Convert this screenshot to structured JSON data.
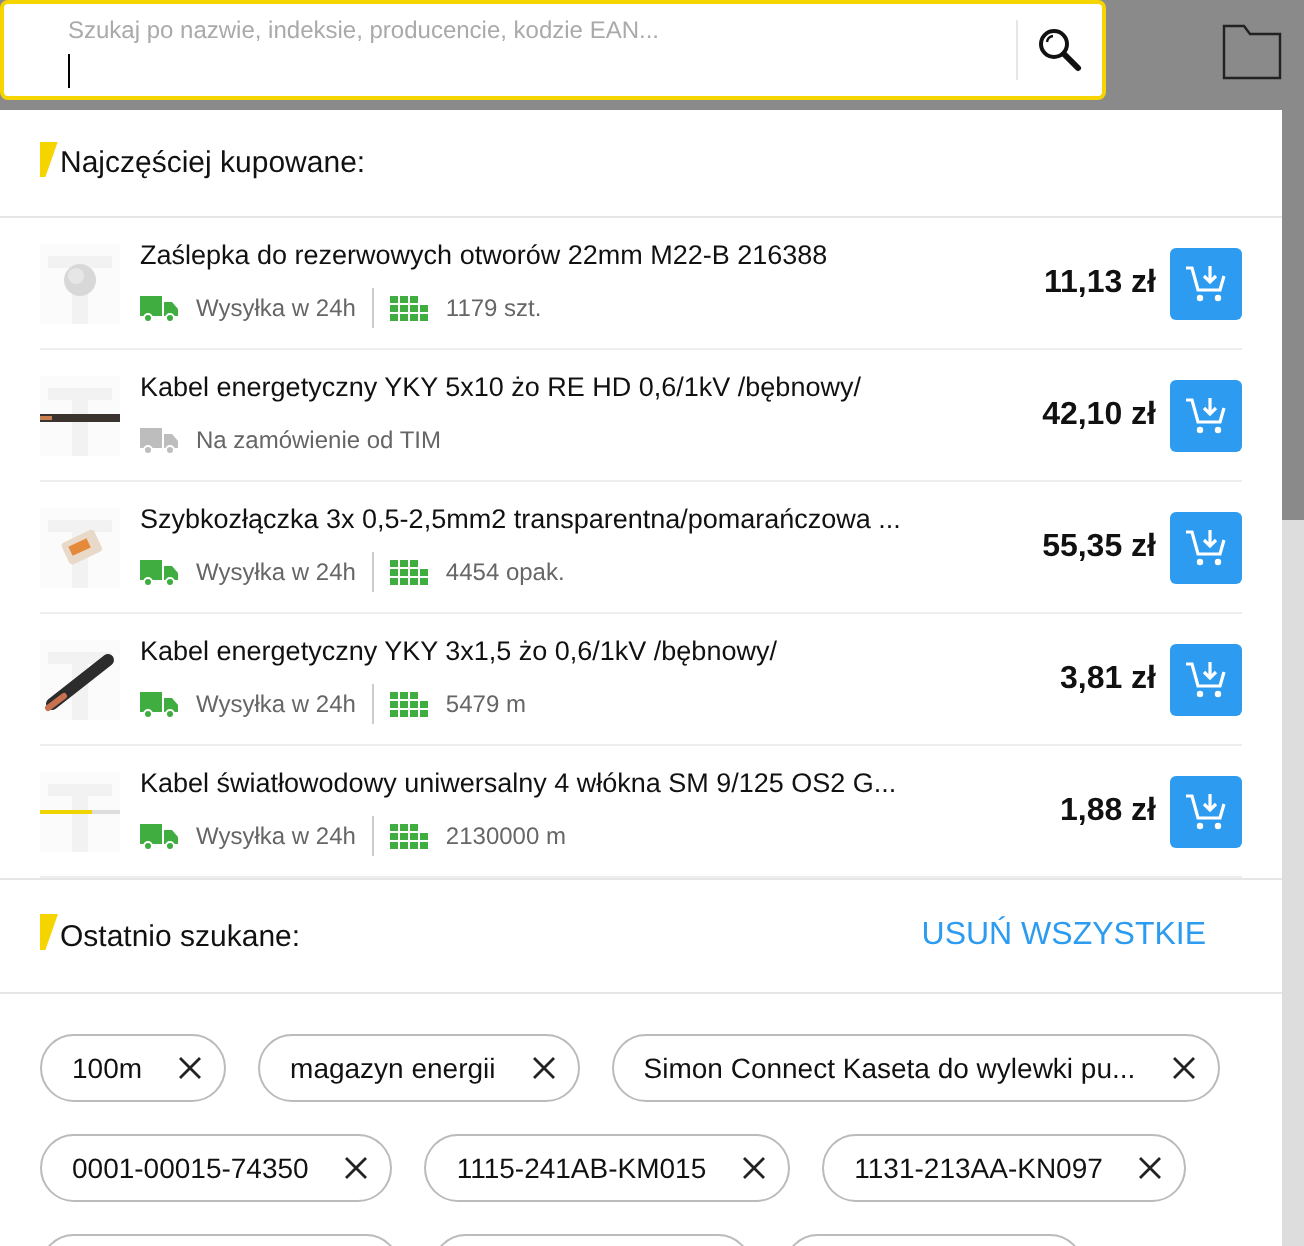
{
  "search": {
    "placeholder": "Szukaj po nazwie, indeksie, producencie, kodzie EAN..."
  },
  "most_bought": {
    "title": "Najczęściej kupowane:",
    "products": [
      {
        "name": "Zaślepka do rezerwowych otworów 22mm M22-B 216388",
        "available": true,
        "delivery": "Wysyłka w 24h",
        "stock": "1179 szt.",
        "price": "11,13 zł"
      },
      {
        "name": "Kabel energetyczny YKY 5x10 żo RE HD 0,6/1kV /bębnowy/",
        "available": false,
        "delivery": "Na zamówienie od TIM",
        "price": "42,10 zł"
      },
      {
        "name": "Szybkozłączka 3x 0,5-2,5mm2 transparentna/pomarańczowa ...",
        "available": true,
        "delivery": "Wysyłka w 24h",
        "stock": "4454 opak.",
        "price": "55,35 zł"
      },
      {
        "name": "Kabel energetyczny YKY 3x1,5 żo 0,6/1kV /bębnowy/",
        "available": true,
        "delivery": "Wysyłka w 24h",
        "stock": "5479 m",
        "price": "3,81 zł"
      },
      {
        "name": "Kabel światłowodowy uniwersalny 4 włókna SM 9/125 OS2 G...",
        "available": true,
        "delivery": "Wysyłka w 24h",
        "stock": "2130000 m",
        "price": "1,88 zł"
      }
    ]
  },
  "recent": {
    "title": "Ostatnio szukane:",
    "clear_all": "USUŃ WSZYSTKIE",
    "chips": [
      "100m",
      "magazyn energii",
      "Simon Connect Kaseta do wylewki pu...",
      "0001-00015-74350",
      "1115-241AB-KM015",
      "1131-213AA-KN097"
    ]
  }
}
